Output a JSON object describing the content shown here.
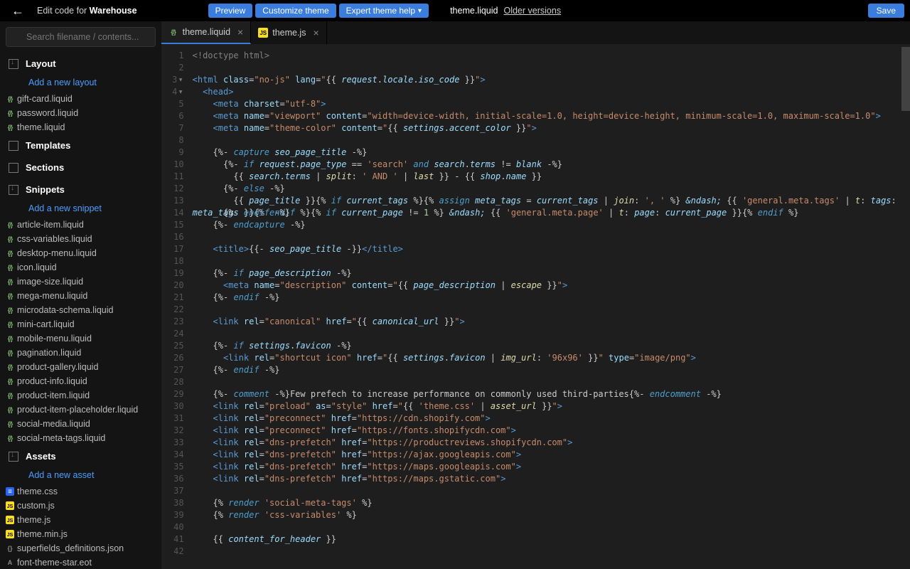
{
  "header": {
    "edit_label": "Edit code for",
    "theme_name": "Warehouse",
    "preview": "Preview",
    "customize": "Customize theme",
    "expert": "Expert theme help",
    "current_file": "theme.liquid",
    "older_versions": "Older versions",
    "save": "Save"
  },
  "search": {
    "placeholder": "Search filename / contents..."
  },
  "sidebar": {
    "layout": {
      "title": "Layout",
      "add": "Add a new layout",
      "files": [
        "gift-card.liquid",
        "password.liquid",
        "theme.liquid"
      ]
    },
    "templates": {
      "title": "Templates"
    },
    "sections": {
      "title": "Sections"
    },
    "snippets": {
      "title": "Snippets",
      "add": "Add a new snippet",
      "files": [
        "article-item.liquid",
        "css-variables.liquid",
        "desktop-menu.liquid",
        "icon.liquid",
        "image-size.liquid",
        "mega-menu.liquid",
        "microdata-schema.liquid",
        "mini-cart.liquid",
        "mobile-menu.liquid",
        "pagination.liquid",
        "product-gallery.liquid",
        "product-info.liquid",
        "product-item.liquid",
        "product-item-placeholder.liquid",
        "social-media.liquid",
        "social-meta-tags.liquid"
      ]
    },
    "assets": {
      "title": "Assets",
      "add": "Add a new asset",
      "files": [
        {
          "name": "theme.css",
          "type": "css"
        },
        {
          "name": "custom.js",
          "type": "js"
        },
        {
          "name": "theme.js",
          "type": "js"
        },
        {
          "name": "theme.min.js",
          "type": "js"
        },
        {
          "name": "superfields_definitions.json",
          "type": "json"
        },
        {
          "name": "font-theme-star.eot",
          "type": "font"
        }
      ]
    }
  },
  "tabs": [
    {
      "name": "theme.liquid",
      "type": "liquid",
      "active": true
    },
    {
      "name": "theme.js",
      "type": "js",
      "active": false
    }
  ],
  "code_lines": 42
}
